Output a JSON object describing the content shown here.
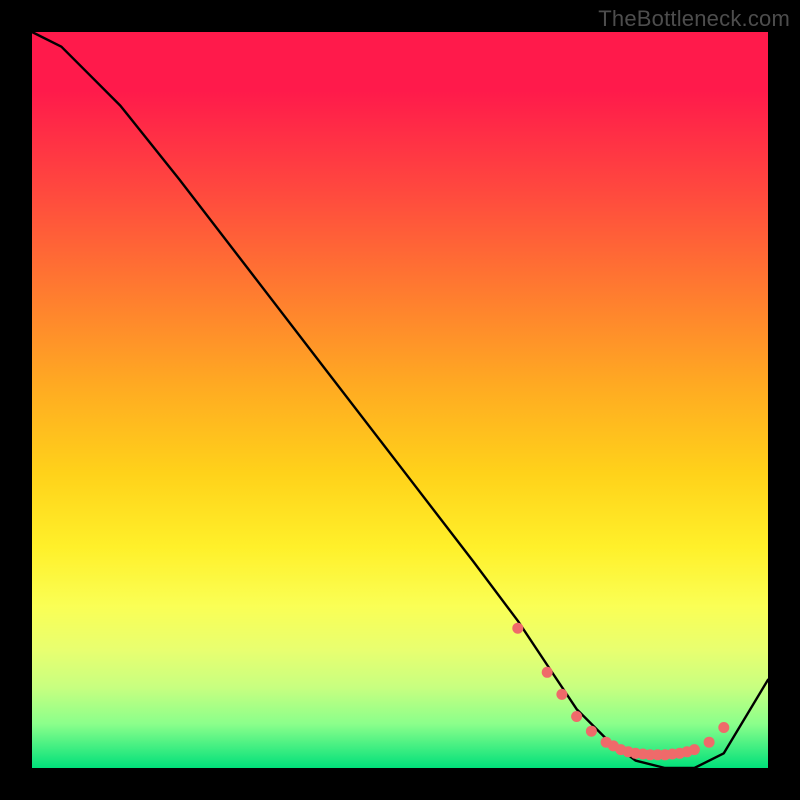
{
  "watermark": "TheBottleneck.com",
  "chart_data": {
    "type": "line",
    "title": "",
    "xlabel": "",
    "ylabel": "",
    "xlim": [
      0,
      100
    ],
    "ylim": [
      0,
      100
    ],
    "grid": false,
    "legend": false,
    "series": [
      {
        "name": "bottleneck-curve",
        "x": [
          0,
          4,
          8,
          12,
          20,
          30,
          40,
          50,
          60,
          66,
          70,
          74,
          78,
          82,
          86,
          90,
          94,
          100
        ],
        "y": [
          100,
          98,
          94,
          90,
          80,
          67,
          54,
          41,
          28,
          20,
          14,
          8,
          4,
          1,
          0,
          0,
          2,
          12
        ]
      }
    ],
    "markers": {
      "name": "hotspot-dots",
      "color": "#ef6a6a",
      "points": [
        {
          "x": 66,
          "y": 19
        },
        {
          "x": 70,
          "y": 13
        },
        {
          "x": 72,
          "y": 10
        },
        {
          "x": 74,
          "y": 7
        },
        {
          "x": 76,
          "y": 5
        },
        {
          "x": 78,
          "y": 3.5
        },
        {
          "x": 79,
          "y": 3
        },
        {
          "x": 80,
          "y": 2.5
        },
        {
          "x": 81,
          "y": 2.2
        },
        {
          "x": 82,
          "y": 2.0
        },
        {
          "x": 83,
          "y": 1.9
        },
        {
          "x": 84,
          "y": 1.8
        },
        {
          "x": 85,
          "y": 1.8
        },
        {
          "x": 86,
          "y": 1.8
        },
        {
          "x": 87,
          "y": 1.9
        },
        {
          "x": 88,
          "y": 2.0
        },
        {
          "x": 89,
          "y": 2.2
        },
        {
          "x": 90,
          "y": 2.5
        },
        {
          "x": 92,
          "y": 3.5
        },
        {
          "x": 94,
          "y": 5.5
        }
      ]
    }
  }
}
